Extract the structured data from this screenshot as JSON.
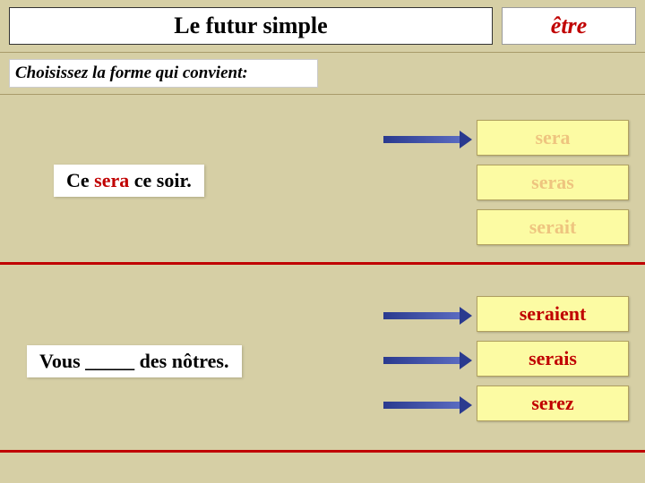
{
  "header": {
    "title": "Le futur simple",
    "verb": "être"
  },
  "instruction": "Choisissez la forme qui convient:",
  "group1": {
    "sentence_pre": "Ce ",
    "sentence_hl": "sera",
    "sentence_post": " ce soir.",
    "options": [
      "sera",
      "seras",
      "serait"
    ]
  },
  "group2": {
    "sentence_pre": "Vous ",
    "sentence_hl": "_____",
    "sentence_post": " des nôtres.",
    "options": [
      "seraient",
      "serais",
      "serez"
    ]
  }
}
